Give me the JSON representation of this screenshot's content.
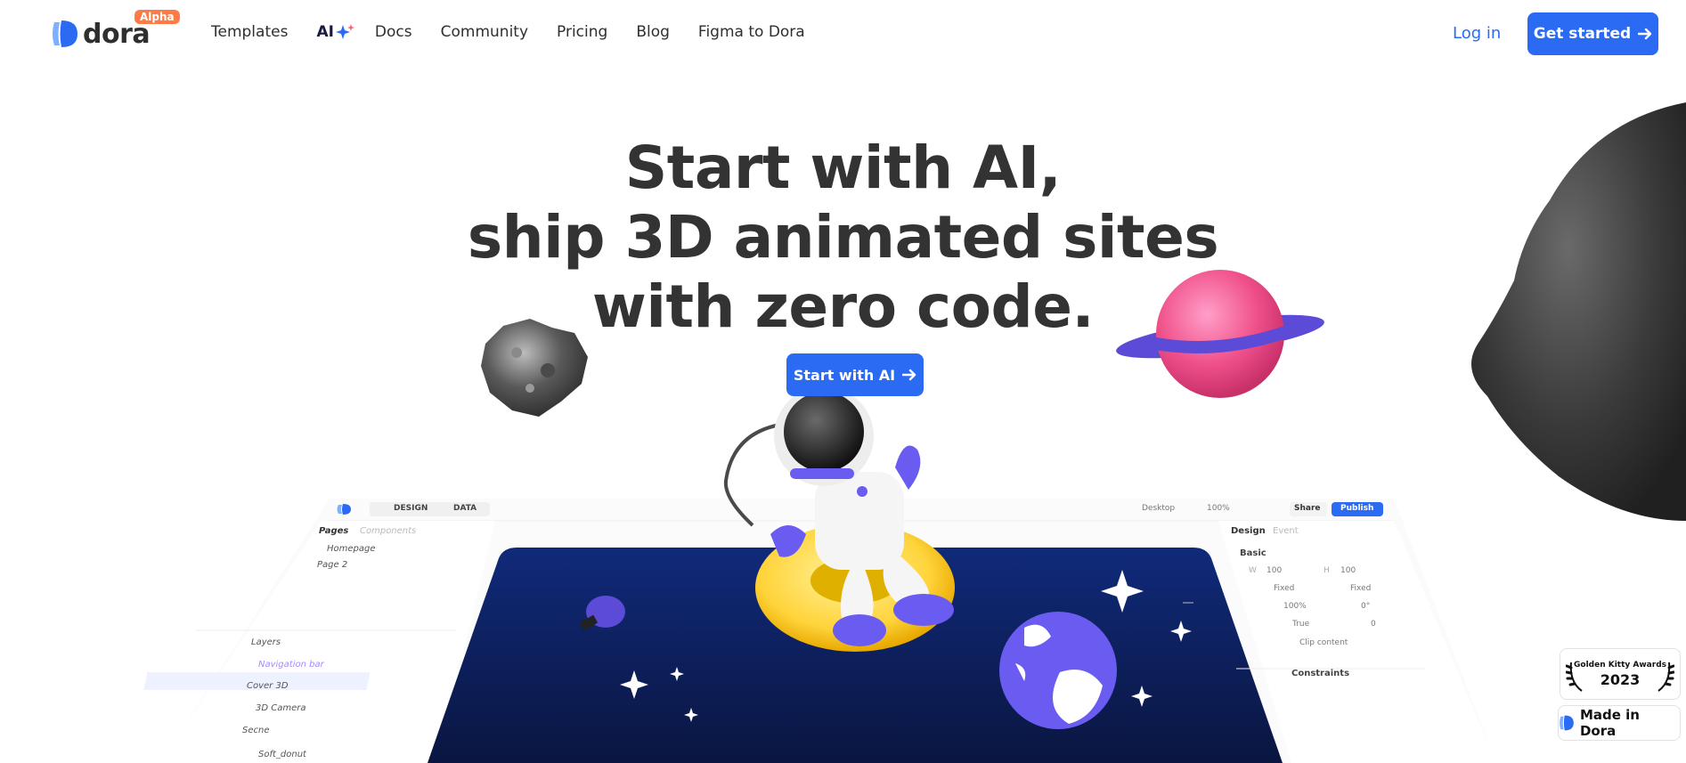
{
  "nav": {
    "logo_text": "dora",
    "alpha_badge": "Alpha",
    "links": [
      "Templates",
      "Docs",
      "Community",
      "Pricing",
      "Blog",
      "Figma to Dora"
    ],
    "ai_label": "AI",
    "login": "Log in",
    "get_started": "Get started"
  },
  "hero": {
    "line1": "Start with AI,",
    "line2": "ship 3D animated sites",
    "line3": "with zero code.",
    "cta": "Start with AI"
  },
  "editor": {
    "design_tab": "DESIGN",
    "data_tab": "DATA",
    "device": "Desktop",
    "zoom": "100%",
    "share": "Share",
    "publish": "Publish",
    "pages_tab": "Pages",
    "components_tab": "Components",
    "pages": [
      "Homepage",
      "Page 2"
    ],
    "layers_title": "Layers",
    "layers": [
      "Navigation bar",
      "Cover 3D",
      "3D Camera",
      "Secne",
      "Soft_donut"
    ],
    "right_tabs": [
      "Design",
      "Event"
    ],
    "basic": "Basic",
    "w_label": "W",
    "w_value": "100",
    "h_label": "H",
    "h_value": "100",
    "fixed": "Fixed",
    "opacity": "100%",
    "rotation": "0°",
    "visible": "True",
    "radius": "0",
    "clip": "Clip content",
    "constraints": "Constraints"
  },
  "badges": {
    "award_title": "Golden Kitty Awards",
    "award_year": "2023",
    "made_in": "Made in Dora"
  },
  "colors": {
    "brand_blue": "#2b6bf3",
    "alpha_orange": "#ff7a45",
    "headline": "#333333",
    "screen_navy": "#0f2466"
  }
}
